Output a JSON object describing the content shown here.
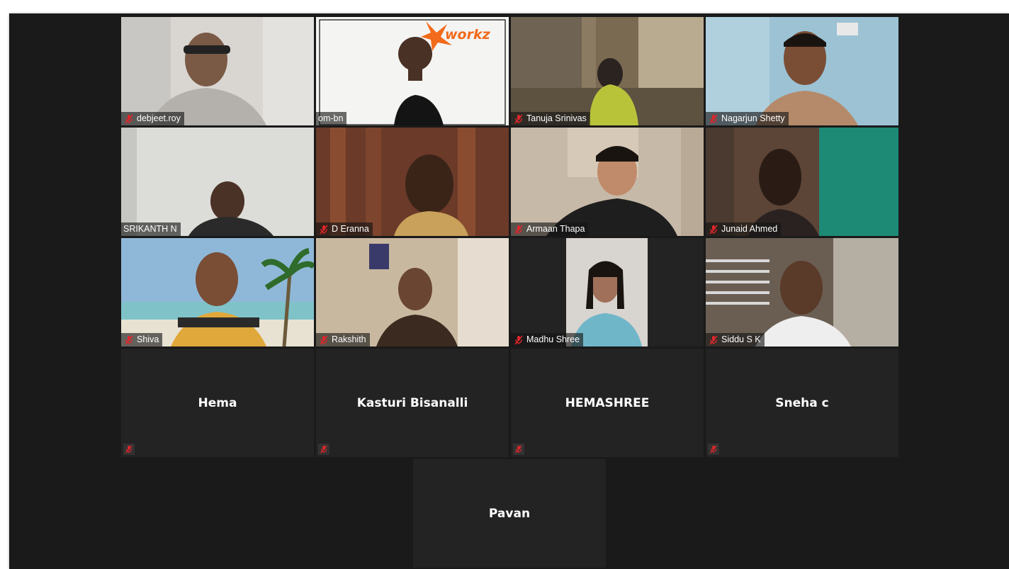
{
  "meeting": {
    "participants": [
      {
        "name": "debjeet.roy",
        "muted": true,
        "video": true,
        "scene": "room-light"
      },
      {
        "name": "om-bn",
        "muted": false,
        "video": true,
        "scene": "brand-wall",
        "active_speaker": true,
        "brand_logo_text": "workz"
      },
      {
        "name": "Tanuja Srinivas",
        "muted": true,
        "video": true,
        "scene": "kitchen"
      },
      {
        "name": "Nagarjun Shetty",
        "muted": true,
        "video": true,
        "scene": "blue-wall"
      },
      {
        "name": "SRIKANTH N",
        "muted": false,
        "video": true,
        "scene": "white-wall"
      },
      {
        "name": "D Eranna",
        "muted": true,
        "video": true,
        "scene": "curtain"
      },
      {
        "name": "Armaan Thapa",
        "muted": true,
        "video": true,
        "scene": "doorway"
      },
      {
        "name": "Junaid Ahmed",
        "muted": true,
        "video": true,
        "scene": "teal-door"
      },
      {
        "name": "Shiva",
        "muted": true,
        "video": true,
        "scene": "beach"
      },
      {
        "name": "Rakshith",
        "muted": true,
        "video": true,
        "scene": "bedroom"
      },
      {
        "name": "Madhu Shree",
        "muted": true,
        "video": true,
        "scene": "portrait"
      },
      {
        "name": "Siddu S K",
        "muted": true,
        "video": true,
        "scene": "lattice"
      },
      {
        "name": "Hema",
        "muted": true,
        "video": false
      },
      {
        "name": "Kasturi Bisanalli",
        "muted": true,
        "video": false
      },
      {
        "name": "HEMASHREE",
        "muted": true,
        "video": false
      },
      {
        "name": "Sneha c",
        "muted": true,
        "video": false
      },
      {
        "name": "Pavan",
        "muted": false,
        "video": false
      }
    ]
  },
  "colors": {
    "stage_bg": "#1a1a1a",
    "tile_bg": "#232323",
    "muted_icon": "#e0262b",
    "active_speaker_border": "#e6e27a",
    "brand_orange": "#f26a1b"
  },
  "icons": {
    "muted": "microphone-muted-icon"
  }
}
